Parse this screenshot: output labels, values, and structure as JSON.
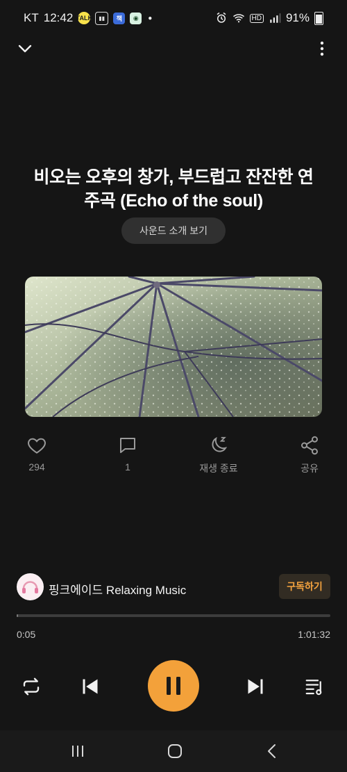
{
  "status_bar": {
    "carrier": "KT",
    "time": "12:42",
    "talk_badge": "TALK",
    "app_badge_1": "책",
    "battery_percent": "91%"
  },
  "track": {
    "title": "비오는 오후의 창가, 부드럽고 잔잔한 연주곡 (Echo of the soul)",
    "intro_button": "사운드 소개 보기"
  },
  "actions": {
    "like_count": "294",
    "comment_count": "1",
    "sleep_label": "재생 종료",
    "share_label": "공유"
  },
  "channel": {
    "name": "핑크에이드 Relaxing Music",
    "subscribe_label": "구독하기"
  },
  "playback": {
    "current_time": "0:05",
    "total_time": "1:01:32",
    "progress_fraction": 0.0014
  },
  "colors": {
    "accent": "#f3a13a",
    "background": "#151515"
  },
  "icons": [
    "chevron-down-icon",
    "more-vertical-icon",
    "heart-icon",
    "comment-icon",
    "sleep-timer-icon",
    "share-icon",
    "repeat-icon",
    "previous-icon",
    "pause-icon",
    "next-icon",
    "playlist-icon"
  ]
}
